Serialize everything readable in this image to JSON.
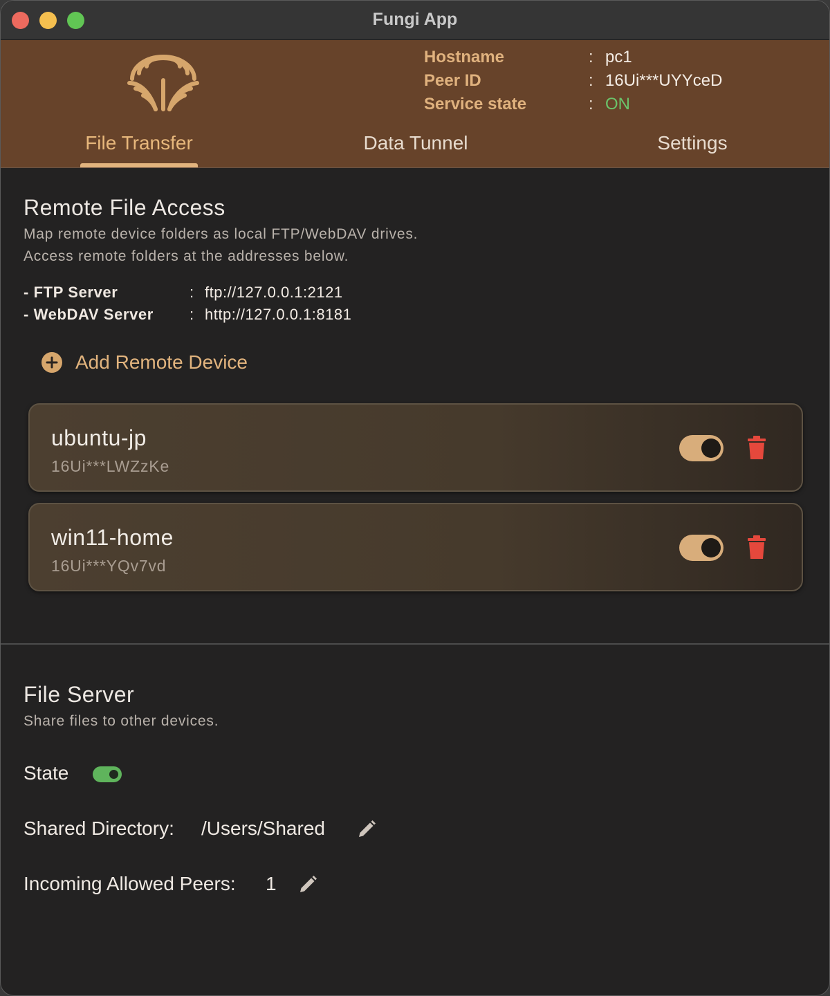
{
  "window": {
    "title": "Fungi App"
  },
  "header": {
    "info": [
      {
        "key": "Hostname",
        "value": "pc1"
      },
      {
        "key": "Peer ID",
        "value": "16Ui***UYYceD"
      },
      {
        "key": "Service state",
        "value": "ON"
      }
    ],
    "colon": ":",
    "tabs": [
      {
        "label": "File Transfer",
        "active": true
      },
      {
        "label": "Data Tunnel",
        "active": false
      },
      {
        "label": "Settings",
        "active": false
      }
    ]
  },
  "remote_access": {
    "title": "Remote File Access",
    "desc_line1": "Map remote device folders as local FTP/WebDAV drives.",
    "desc_line2": "Access remote folders at the addresses below.",
    "servers": [
      {
        "key": "- FTP Server",
        "value": "ftp://127.0.0.1:2121"
      },
      {
        "key": "- WebDAV Server",
        "value": "http://127.0.0.1:8181"
      }
    ],
    "add_label": "Add Remote Device",
    "devices": [
      {
        "name": "ubuntu-jp",
        "peer_id": "16Ui***LWZzKe",
        "enabled": true
      },
      {
        "name": "win11-home",
        "peer_id": "16Ui***YQv7vd",
        "enabled": true
      }
    ]
  },
  "file_server": {
    "title": "File Server",
    "desc": "Share files to other devices.",
    "state_label": "State",
    "state_on": true,
    "shared_dir_label": "Shared Directory:",
    "shared_dir_value": "/Users/Shared",
    "allowed_peers_label": "Incoming Allowed Peers:",
    "allowed_peers_value": "1"
  },
  "colors": {
    "header_bg": "#67432a",
    "accent": "#e2b47e",
    "on_green": "#6bc46b",
    "danger": "#e5483c",
    "body_bg": "#232222"
  },
  "icons": {
    "logo": "fungi-logo-icon",
    "add": "plus-circle-icon",
    "delete": "trash-icon",
    "edit": "pencil-icon"
  }
}
